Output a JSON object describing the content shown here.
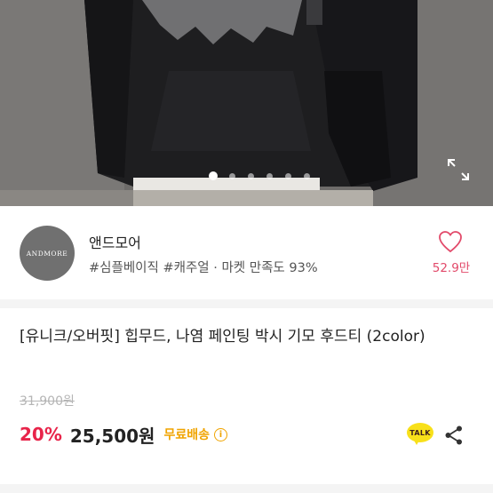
{
  "hero": {
    "image_alt": "hoodie photo",
    "slide_count": 6,
    "active_slide": 1,
    "expand_icon": "expand-icon"
  },
  "seller": {
    "avatar_text": "ANDMORE",
    "name": "앤드모어",
    "tags": "#심플베이직 #캐주얼 · 마켓 만족도 93%",
    "like_icon": "heart-outline-icon",
    "like_count": "52.9만",
    "like_color": "#e24a6a"
  },
  "product": {
    "title": "[유니크/오버핏] 힙무드, 나염 페인팅 박시 기모 후드티 (2color)",
    "original_price": "31,900원",
    "discount": "20%",
    "price": "25,500원",
    "shipping": "무료배송",
    "info_icon": "info-icon",
    "discount_color": "#e8244a",
    "shipping_color": "#f0a400"
  },
  "actions": {
    "talk_label": "TALK",
    "talk_icon": "kakao-talk-icon",
    "share_icon": "share-icon"
  }
}
